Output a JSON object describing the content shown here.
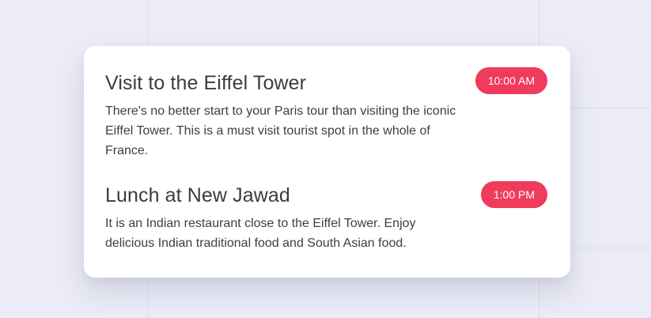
{
  "events": [
    {
      "title": "Visit to the Eiffel Tower",
      "description": "There's no better start to your Paris tour than visiting the iconic Eiffel Tower. This is a must visit tourist spot in the whole of France.",
      "time": "10:00 AM"
    },
    {
      "title": "Lunch at New Jawad",
      "description": "It is an Indian restaurant close to the Eiffel Tower. Enjoy delicious Indian traditional food and South Asian food.",
      "time": "1:00 PM"
    }
  ],
  "colors": {
    "background": "#ebecf7",
    "card": "#ffffff",
    "badge": "#ef3b5c",
    "text": "#3c3c3c"
  }
}
